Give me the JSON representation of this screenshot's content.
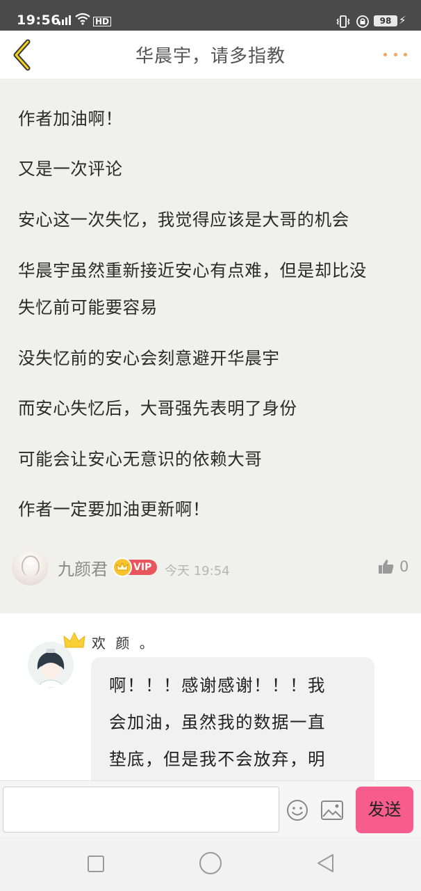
{
  "status_bar": {
    "time": "19:56",
    "network": "4G",
    "hd": "HD",
    "battery": "98"
  },
  "header": {
    "title": "华晨宇，请多指教"
  },
  "comment": {
    "lines": [
      "作者加油啊！",
      "又是一次评论",
      "安心这一次失忆，我觉得应该是大哥的机会",
      "华晨宇虽然重新接近安心有点难，但是却比没",
      "失忆前可能要容易",
      "没失忆前的安心会刻意避开华晨宇",
      "而安心失忆后，大哥强先表明了身份",
      "可能会让安心无意识的依赖大哥",
      "作者一定要加油更新啊！"
    ],
    "username": "九颜君",
    "vip_label": "VIP",
    "timestamp": "今天 19:54",
    "like_count": "0"
  },
  "reply": {
    "name": "欢 颜 。",
    "lines": [
      "啊！！！感谢感谢！！！我",
      "会加油，虽然我的数据一直",
      "垫底，但是我不会放弃，明"
    ]
  },
  "input_bar": {
    "placeholder": "",
    "send_label": "发送"
  },
  "colors": {
    "accent_orange": "#f5a35a",
    "send_pink": "#f65d8e",
    "vip_red": "#e8555c",
    "crown_yellow": "#f7c42e",
    "comment_bg": "#f0f0ec"
  },
  "icons": [
    "back-chevron-icon",
    "more-dots-icon",
    "thumbs-up-icon",
    "emoji-icon",
    "image-icon",
    "crown-icon"
  ]
}
